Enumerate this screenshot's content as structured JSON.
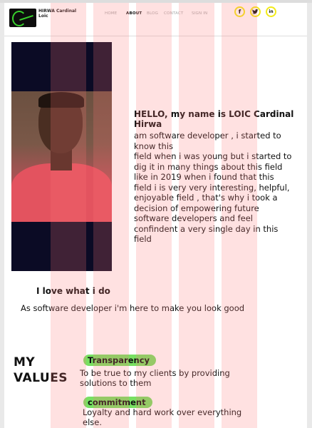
{
  "header": {
    "logo_name": "HIRWA Cardinal Loic",
    "nav": [
      "HOME",
      "ABOUT",
      "BLOG",
      "CONTACT",
      "SIGN IN"
    ],
    "active_nav": "ABOUT",
    "social": [
      {
        "icon": "facebook-icon",
        "glyph": "f"
      },
      {
        "icon": "twitter-icon",
        "glyph": "🐦"
      },
      {
        "icon": "linkedin-icon",
        "glyph": "in"
      }
    ],
    "accent": "#f2ea1a"
  },
  "about": {
    "heading": "HELLO, my name is LOIC Cardinal Hirwa",
    "bio_lines": [
      "am software developer , i started to know this",
      "field when i was young but i started to dig it in many things  about this field like in 2019 when i found that this field i is very very interesting, helpful,",
      "enjoyable field , that's why i took a decision of empowering future software developers and feel confindent a very single day in this field"
    ],
    "love": "I love what i do",
    "tagline": "As software developer i'm  here to make you look good"
  },
  "values": {
    "title_line1": "MY",
    "title_line2": "VALUES",
    "items": [
      {
        "name": "Transparency",
        "text": "To be true  to my clients by providing solutions to them"
      },
      {
        "name": "commitment",
        "text": "Loyalty and hard work over everything else."
      }
    ],
    "pill_color": "#78e062"
  }
}
